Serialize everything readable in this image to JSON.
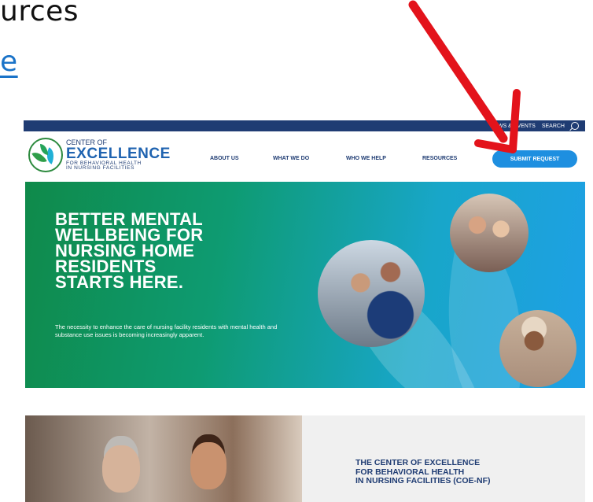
{
  "slide": {
    "line1": "urces",
    "line2": "e"
  },
  "site": {
    "topbar": {
      "news_events": "NEWS & EVENTS",
      "search": "SEARCH"
    },
    "logo": {
      "line1": "CENTER OF",
      "line2": "EXCELLENCE",
      "line3": "FOR BEHAVIORAL HEALTH",
      "line4": "IN NURSING FACILITIES"
    },
    "nav": {
      "about": "ABOUT US",
      "what": "WHAT WE DO",
      "who": "WHO WE HELP",
      "resources": "RESOURCES",
      "submit": "SUBMIT REQUEST"
    },
    "hero": {
      "title_lines": [
        "BETTER MENTAL",
        "WELLBEING FOR",
        "NURSING HOME",
        "RESIDENTS",
        "STARTS HERE."
      ],
      "subtitle": "The necessity to enhance the care of nursing facility residents with mental health and substance use issues is becoming increasingly apparent."
    },
    "lower": {
      "title_lines": [
        "THE CENTER OF EXCELLENCE",
        "FOR BEHAVIORAL HEALTH",
        "IN NURSING FACILITIES (COE-NF)"
      ]
    }
  },
  "colors": {
    "brand_navy": "#1f3c73",
    "button_blue": "#1e8fe0",
    "annotation_red": "#e3131b"
  },
  "icons": {
    "search": "search-icon",
    "annotation": "red-arrow-icon"
  }
}
